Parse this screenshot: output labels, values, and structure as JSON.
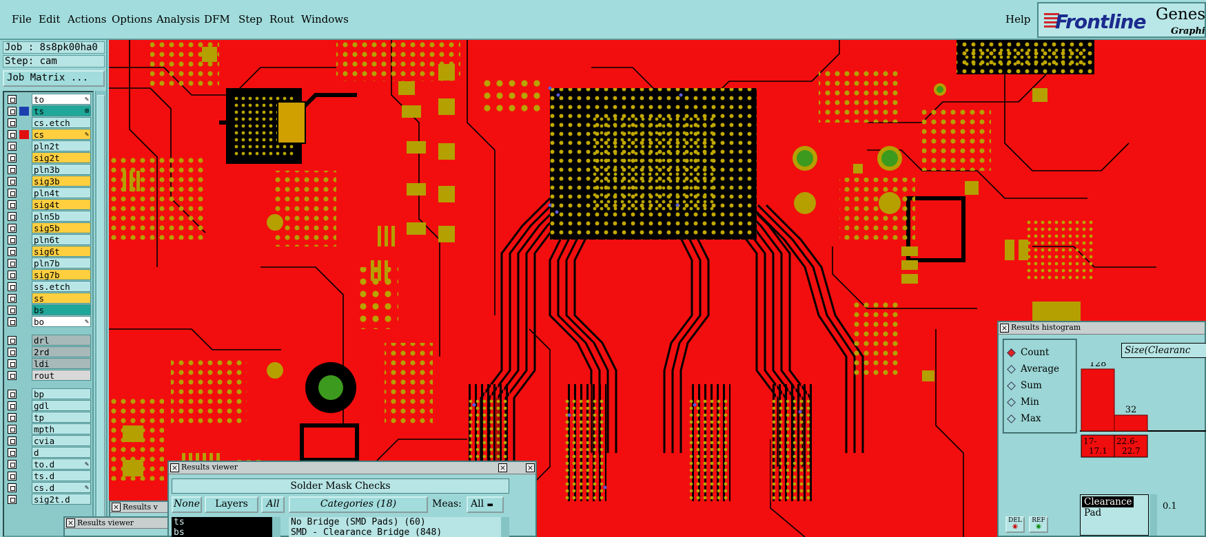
{
  "menubar": {
    "items": [
      {
        "label": "File"
      },
      {
        "label": "Edit"
      },
      {
        "label": "Actions"
      },
      {
        "label": "Options"
      },
      {
        "label": "Analysis"
      },
      {
        "label": "DFM"
      },
      {
        "label": "Step"
      },
      {
        "label": "Rout"
      },
      {
        "label": "Windows"
      }
    ],
    "help": "Help",
    "logo": {
      "brand": "Frontline",
      "product": "Genesis",
      "subtitle": "Graphic"
    }
  },
  "job": {
    "job_line": "Job : 8s8pk00ha0",
    "step_line": "Step: cam",
    "matrix_button": "Job Matrix ..."
  },
  "layers": [
    {
      "name": "to",
      "bg": "#ffffff",
      "mark": "✎"
    },
    {
      "name": "ts",
      "bg": "#1fa89a",
      "mark": "⊞",
      "color": "#1b3fae",
      "active": true
    },
    {
      "name": "cs.etch",
      "bg": "#b8e6e6"
    },
    {
      "name": "cs",
      "bg": "#ffcf40",
      "mark": "✎",
      "color": "#e01010"
    },
    {
      "name": "pln2t",
      "bg": "#b8e6e6"
    },
    {
      "name": "sig2t",
      "bg": "#ffcf40"
    },
    {
      "name": "pln3b",
      "bg": "#b8e6e6"
    },
    {
      "name": "sig3b",
      "bg": "#ffcf40"
    },
    {
      "name": "pln4t",
      "bg": "#b8e6e6"
    },
    {
      "name": "sig4t",
      "bg": "#ffcf40"
    },
    {
      "name": "pln5b",
      "bg": "#b8e6e6"
    },
    {
      "name": "sig5b",
      "bg": "#ffcf40"
    },
    {
      "name": "pln6t",
      "bg": "#b8e6e6"
    },
    {
      "name": "sig6t",
      "bg": "#ffcf40"
    },
    {
      "name": "pln7b",
      "bg": "#b8e6e6"
    },
    {
      "name": "sig7b",
      "bg": "#ffcf40"
    },
    {
      "name": "ss.etch",
      "bg": "#b8e6e6"
    },
    {
      "name": "ss",
      "bg": "#ffcf40"
    },
    {
      "name": "bs",
      "bg": "#1fa89a"
    },
    {
      "name": "bo",
      "bg": "#ffffff",
      "mark": "✎"
    },
    {
      "name": "drl",
      "bg": "#a7b9b9"
    },
    {
      "name": "2rd",
      "bg": "#a7b9b9"
    },
    {
      "name": "ldi",
      "bg": "#a7b9b9"
    },
    {
      "name": "rout",
      "bg": "#d8d8d8"
    },
    {
      "name": "bp",
      "bg": "#b8e6e6"
    },
    {
      "name": "gdl",
      "bg": "#b8e6e6"
    },
    {
      "name": "tp",
      "bg": "#b8e6e6"
    },
    {
      "name": "mpth",
      "bg": "#b8e6e6"
    },
    {
      "name": "cvia",
      "bg": "#b8e6e6"
    },
    {
      "name": "d",
      "bg": "#b8e6e6"
    },
    {
      "name": "to.d",
      "bg": "#b8e6e6",
      "mark": "✎"
    },
    {
      "name": "ts.d",
      "bg": "#b8e6e6"
    },
    {
      "name": "cs.d",
      "bg": "#b8e6e6",
      "mark": "✎"
    },
    {
      "name": "sig2t.d",
      "bg": "#b8e6e6"
    }
  ],
  "histogram": {
    "title": "Results histogram",
    "options": [
      {
        "label": "Count",
        "selected": true
      },
      {
        "label": "Average",
        "selected": false
      },
      {
        "label": "Sum",
        "selected": false
      },
      {
        "label": "Min",
        "selected": false
      },
      {
        "label": "Max",
        "selected": false
      }
    ],
    "size_field": "Size(Clearanc",
    "bars": [
      {
        "range_line1": "17-",
        "range_line2": "17.1",
        "value": 128
      },
      {
        "range_line1": "22.6-",
        "range_line2": "22.7",
        "value": 32
      }
    ],
    "del_label": "DEL",
    "ref_label": "REF",
    "list": {
      "selected": "Clearance",
      "other": "Pad"
    },
    "value_label": "0.1"
  },
  "viewer": {
    "title": "Results viewer",
    "check_title": "Solder Mask Checks",
    "none_label": "None",
    "layers_label": "Layers",
    "all_label": "All",
    "categories_label": "Categories (18)",
    "meas_label": "Meas:",
    "meas_value": "All",
    "layer_items": [
      "ts",
      "bs"
    ],
    "categories": [
      "No Bridge (SMD Pads) (60)",
      "SMD - Clearance Bridge (848)"
    ]
  },
  "back_viewer_1": {
    "title": "Results v"
  },
  "back_viewer_2": {
    "title": "Results viewer"
  }
}
